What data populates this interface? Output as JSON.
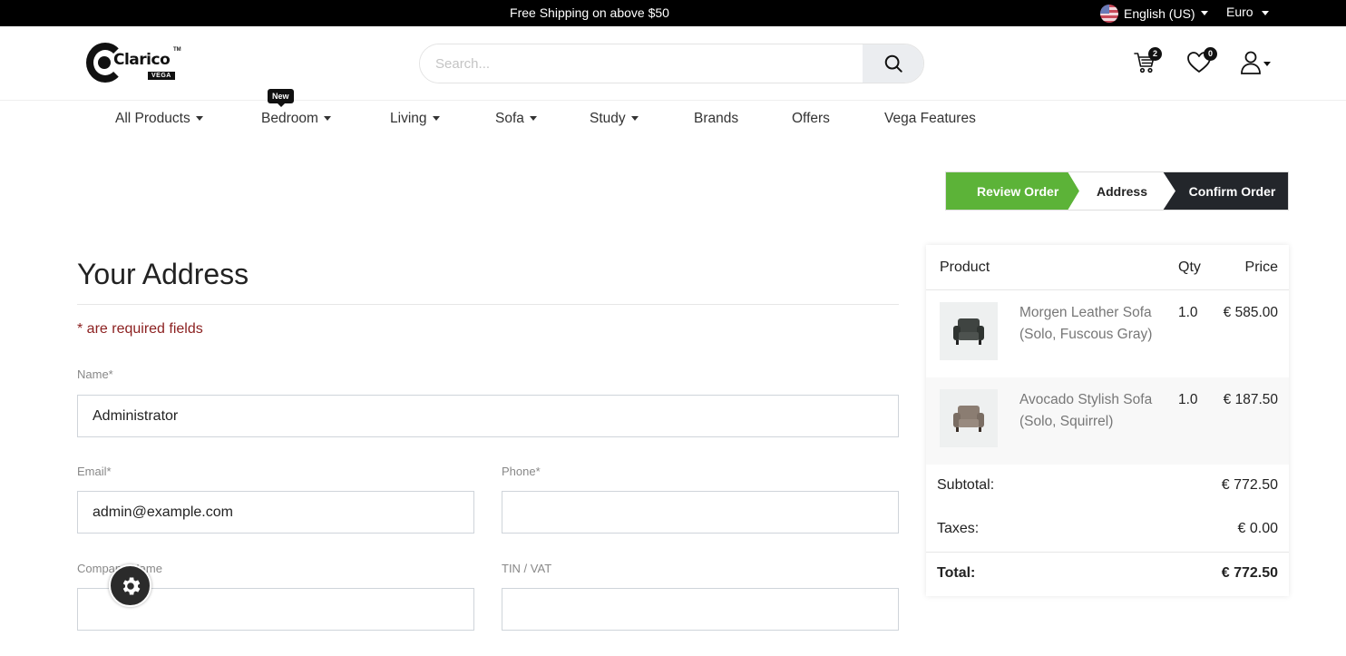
{
  "topbar": {
    "promo": "Free Shipping on above $50",
    "language": "English (US)",
    "currency": "Euro"
  },
  "header": {
    "logo_text": "Clarico",
    "logo_tm": "TM",
    "logo_sub": "VEGA",
    "search_placeholder": "Search...",
    "cart_count": "2",
    "wishlist_count": "0"
  },
  "nav": {
    "items": [
      {
        "label": "All Products",
        "dropdown": true
      },
      {
        "label": "Bedroom",
        "dropdown": true
      },
      {
        "label": "Living",
        "dropdown": true
      },
      {
        "label": "Sofa",
        "dropdown": true
      },
      {
        "label": "Study",
        "dropdown": true
      },
      {
        "label": "Brands",
        "dropdown": false
      },
      {
        "label": "Offers",
        "dropdown": false
      },
      {
        "label": "Vega Features",
        "dropdown": false
      }
    ],
    "new_badge": "New"
  },
  "steps": {
    "review": "Review Order",
    "address": "Address",
    "confirm": "Confirm Order"
  },
  "form": {
    "title": "Your Address",
    "required_note": "* are required fields",
    "name_label": "Name*",
    "name_value": "Administrator",
    "email_label": "Email*",
    "email_value": "admin@example.com",
    "phone_label": "Phone*",
    "phone_value": "",
    "company_label": "Company Name",
    "company_value": "",
    "tin_label": "TIN / VAT",
    "tin_value": ""
  },
  "summary": {
    "headers": {
      "product": "Product",
      "qty": "Qty",
      "price": "Price"
    },
    "items": [
      {
        "name": "Morgen Leather Sofa (Solo, Fuscous Gray)",
        "qty": "1.0",
        "price": "€ 585.00"
      },
      {
        "name": "Avocado Stylish Sofa (Solo, Squirrel)",
        "qty": "1.0",
        "price": "€ 187.50"
      }
    ],
    "subtotal_label": "Subtotal:",
    "subtotal": "€ 772.50",
    "taxes_label": "Taxes:",
    "taxes": "€ 0.00",
    "total_label": "Total:",
    "total": "€ 772.50"
  },
  "colors": {
    "accent_green": "#5cb338",
    "dark": "#23262b",
    "required_red": "#8b1f1f"
  }
}
